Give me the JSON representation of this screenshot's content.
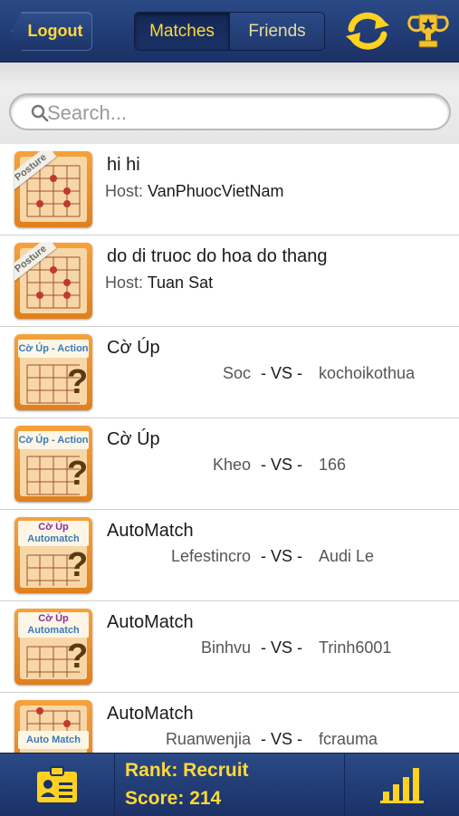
{
  "topbar": {
    "logout_label": "Logout",
    "tabs": [
      {
        "label": "Matches",
        "active": true
      },
      {
        "label": "Friends",
        "active": false
      }
    ],
    "refresh_icon": "refresh-icon",
    "trophy_icon": "trophy-icon",
    "accent_color": "#ffd83a"
  },
  "search": {
    "placeholder": "Search..."
  },
  "rows": [
    {
      "title": "hi hi",
      "host_label": "Host:",
      "host": "VanPhuocVietNam",
      "badge": "Posture"
    },
    {
      "title": "do di truoc do hoa do thang",
      "host_label": "Host:",
      "host": "Tuan Sat",
      "badge": "Posture"
    },
    {
      "title": "Cờ Úp",
      "player1": "Soc",
      "vs": "- VS -",
      "player2": "kochoikothua",
      "badge": "Cờ Úp - Action"
    },
    {
      "title": "Cờ Úp",
      "player1": "Kheo",
      "vs": "- VS -",
      "player2": "166",
      "badge": "Cờ Úp - Action"
    },
    {
      "title": "AutoMatch",
      "player1": "Lefestincro",
      "vs": "- VS -",
      "player2": "Audi Le",
      "badge_line1": "Cờ Úp",
      "badge_line2": "Automatch"
    },
    {
      "title": "AutoMatch",
      "player1": "Binhvu",
      "vs": "- VS -",
      "player2": "Trinh6001",
      "badge_line1": "Cờ Úp",
      "badge_line2": "Automatch"
    },
    {
      "title": "AutoMatch",
      "player1": "Ruanwenjia",
      "vs": "- VS -",
      "player2": "fcrauma",
      "badge": "Auto Match"
    }
  ],
  "bottombar": {
    "rank": "Rank: Recruit",
    "score": "Score: 214",
    "profile_icon": "id-card-icon",
    "stats_icon": "bar-chart-icon"
  }
}
